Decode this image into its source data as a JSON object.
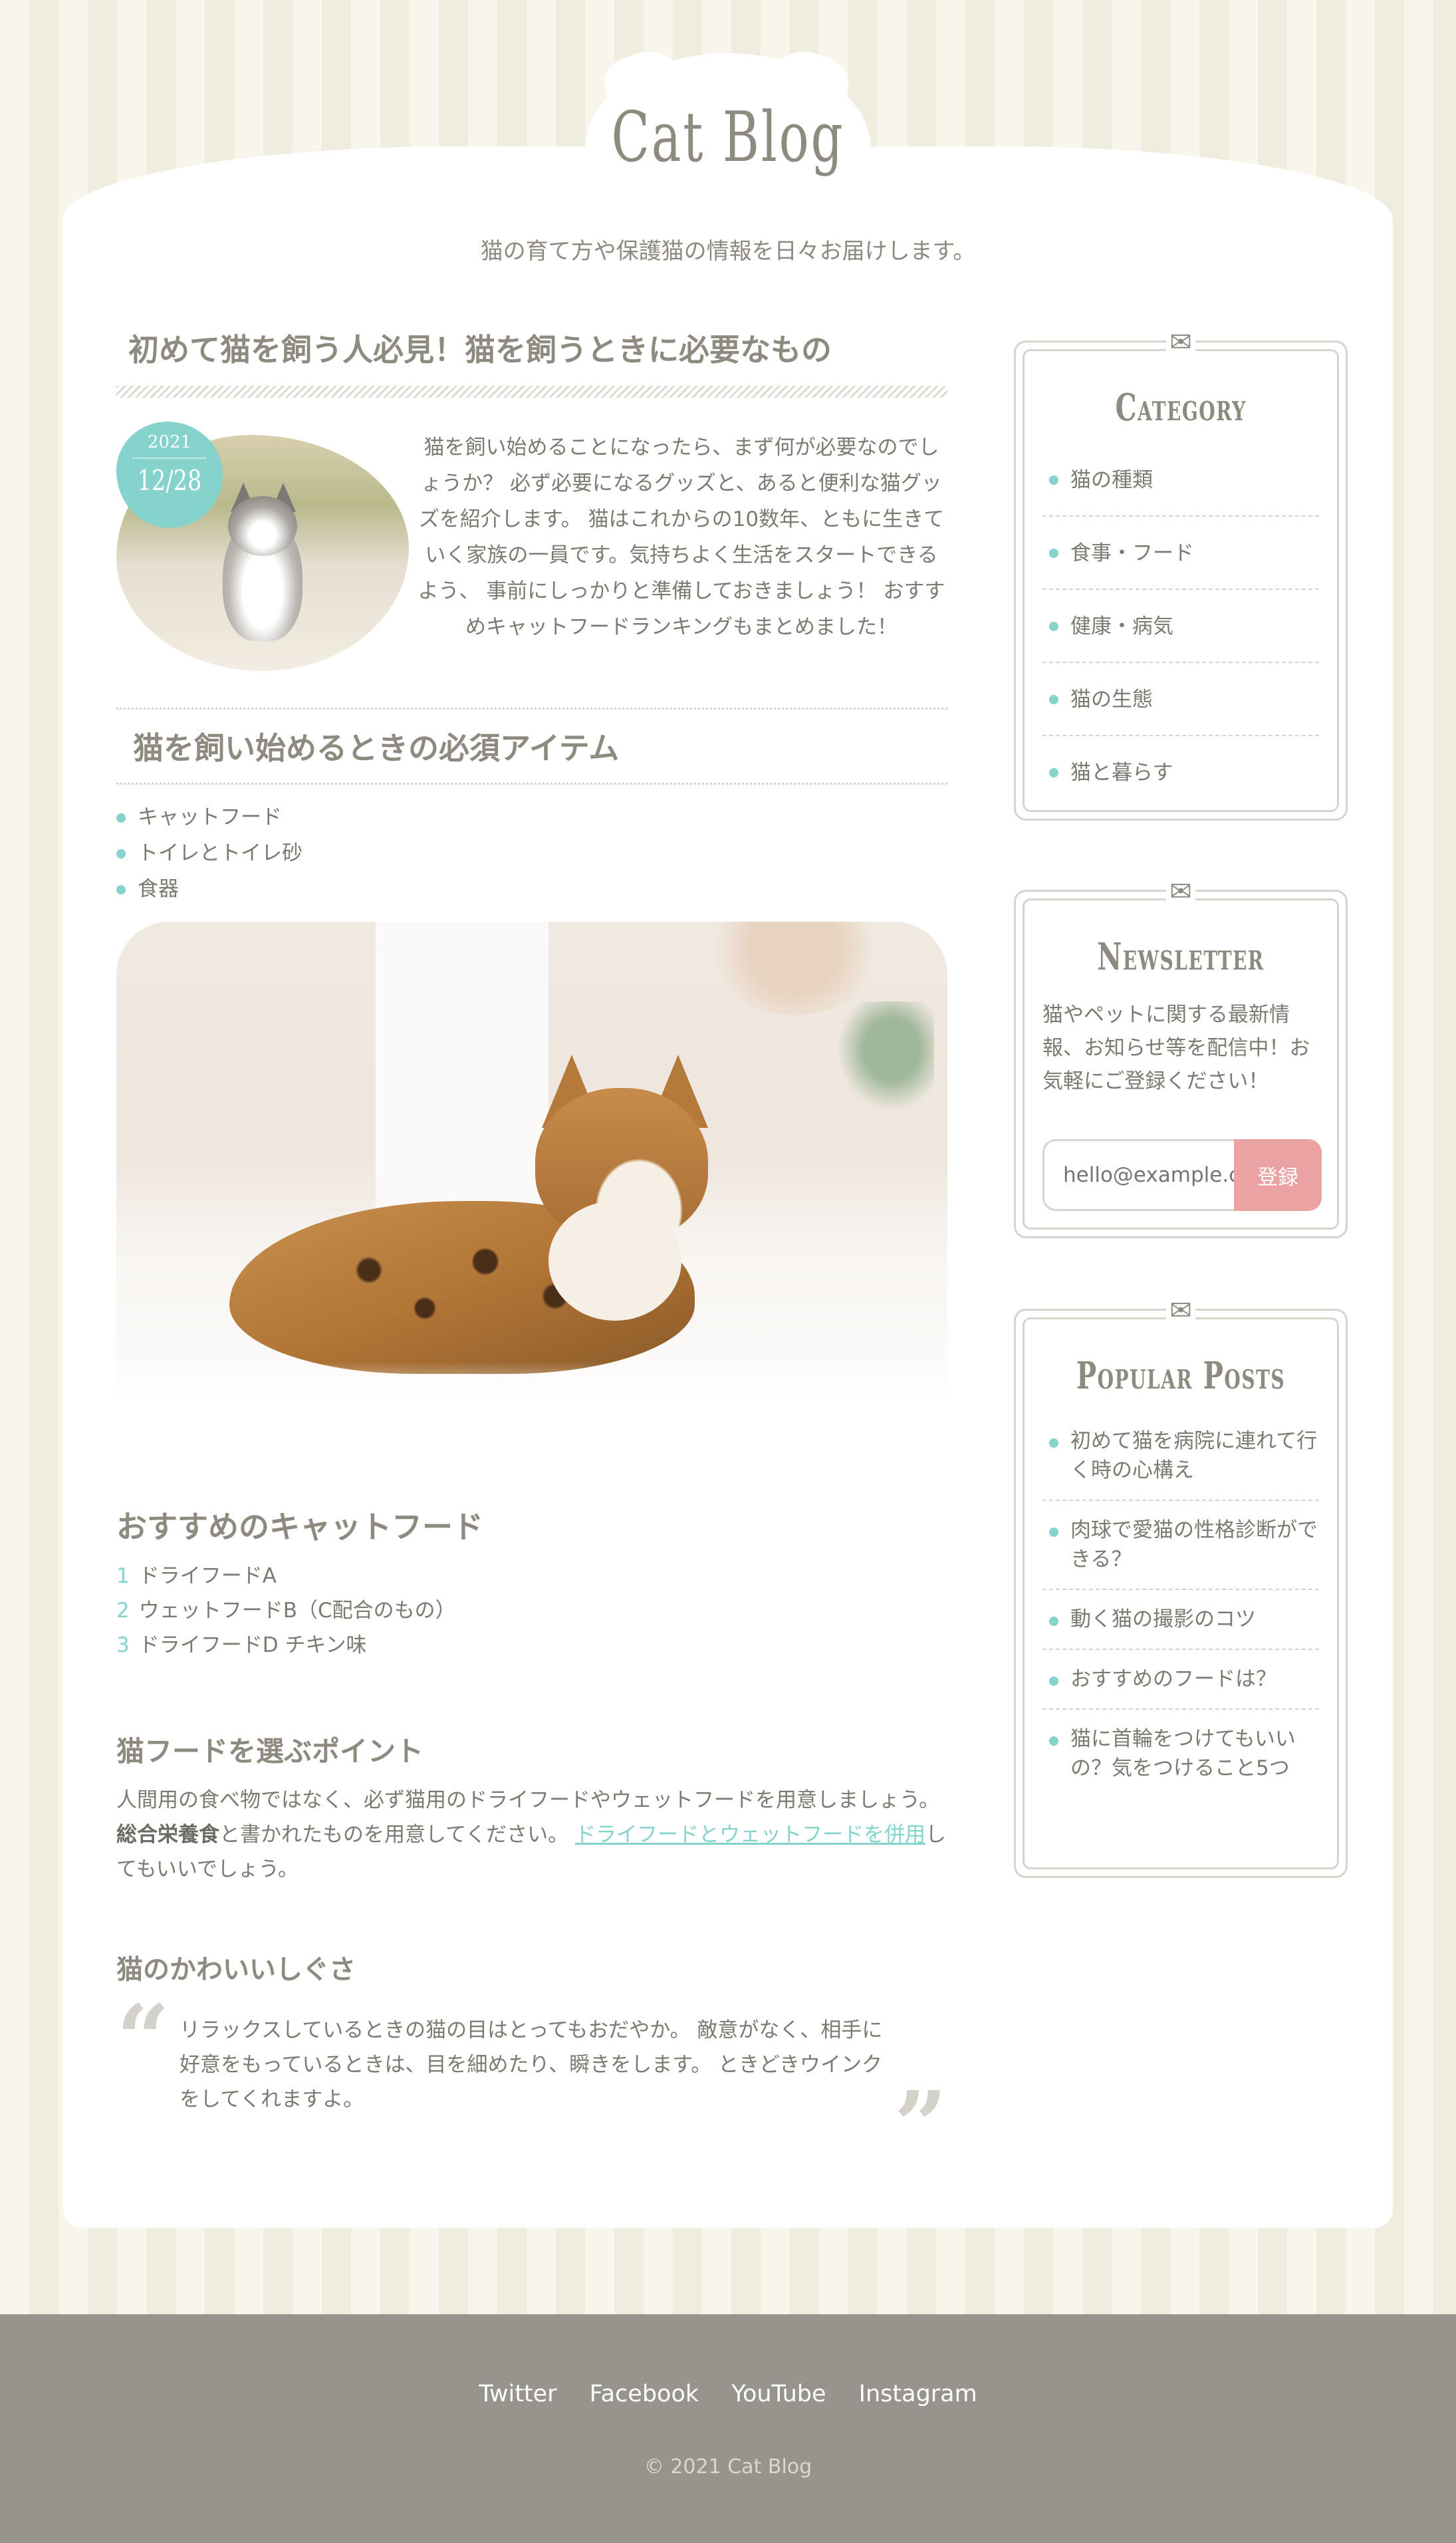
{
  "site": {
    "title": "Cat Blog",
    "tagline": "猫の育て方や保護猫の情報を日々お届けします。"
  },
  "post": {
    "title": "初めて猫を飼う人必見！猫を飼うときに必要なもの",
    "date_year": "2021",
    "date_md": "12/28",
    "intro": "猫を飼い始めることになったら、まず何が必要なのでしょうか？ 必ず必要になるグッズと、あると便利な猫グッズを紹介します。 猫はこれからの10数年、ともに生きていく家族の一員です。気持ちよく生活をスタートできるよう、 事前にしっかりと準備しておきましょう！ おすすめキャットフードランキングもまとめました！",
    "section1_title": "猫を飼い始めるときの必須アイテム",
    "items": [
      "キャットフード",
      "トイレとトイレ砂",
      "食器"
    ],
    "food_title": "おすすめのキャットフード",
    "foods": [
      {
        "n": "1",
        "label": "ドライフードA"
      },
      {
        "n": "2",
        "label": "ウェットフードB（C配合のもの）"
      },
      {
        "n": "3",
        "label": "ドライフードD チキン味"
      }
    ],
    "point_title": "猫フードを選ぶポイント",
    "point_text_1": "人間用の食べ物ではなく、必ず猫用のドライフードやウェットフードを用意しましょう。 ",
    "point_bold": "総合栄養食",
    "point_text_2": "と書かれたものを用意してください。 ",
    "point_link": "ドライフードとウェットフードを併用",
    "point_text_3": "してもいいでしょう。",
    "cute_title": "猫のかわいいしぐさ",
    "quote": "リラックスしているときの猫の目はとってもおだやか。 敵意がなく、相手に好意をもっているときは、目を細めたり、瞬きをします。 ときどきウインクをしてくれますよ。"
  },
  "sidebar": {
    "category": {
      "title": "Category",
      "items": [
        "猫の種類",
        "食事・フード",
        "健康・病気",
        "猫の生態",
        "猫と暮らす"
      ]
    },
    "newsletter": {
      "title": "Newsletter",
      "text": "猫やペットに関する最新情報、お知らせ等を配信中！お気軽にご登録ください！",
      "placeholder": "hello@example.com",
      "button": "登録"
    },
    "popular": {
      "title": "Popular Posts",
      "items": [
        "初めて猫を病院に連れて行く時の心構え",
        "肉球で愛猫の性格診断ができる？",
        "動く猫の撮影のコツ",
        "おすすめのフードは？",
        "猫に首輪をつけてもいいの？気をつけること5つ"
      ]
    }
  },
  "footer": {
    "links": [
      "Twitter",
      "Facebook",
      "YouTube",
      "Instagram"
    ],
    "copyright": "© 2021 Cat Blog"
  },
  "colors": {
    "accent": "#86d2cc",
    "button": "#eba2a2",
    "footer_bg": "#96948c",
    "text": "#7d7a72"
  },
  "icons": {
    "widget": "envelope-icon",
    "quote_open": "quote-open-icon",
    "quote_close": "quote-close-icon"
  }
}
